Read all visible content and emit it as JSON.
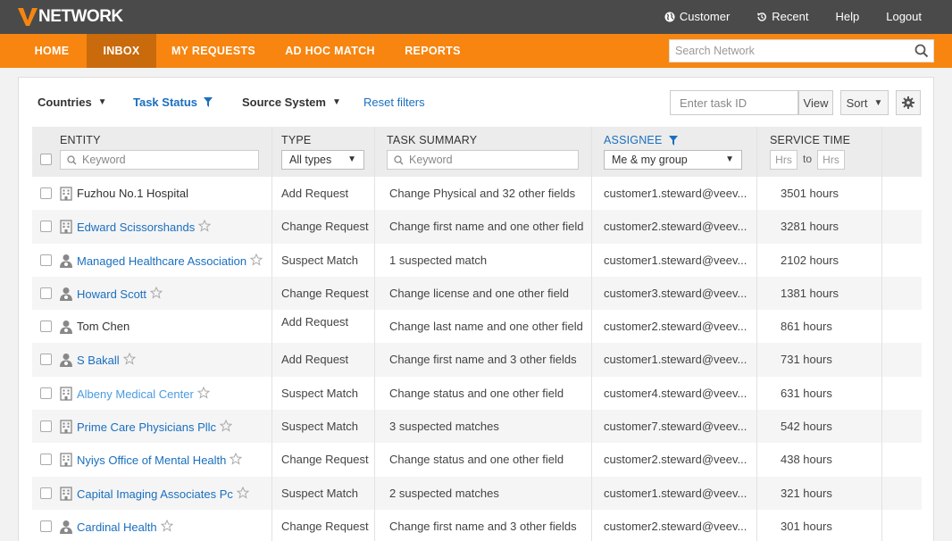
{
  "app": {
    "logo_text": "NETWORK"
  },
  "topnav": {
    "customer": "Customer",
    "recent": "Recent",
    "help": "Help",
    "logout": "Logout"
  },
  "tabs": [
    "HOME",
    "INBOX",
    "MY REQUESTS",
    "AD HOC MATCH",
    "REPORTS"
  ],
  "active_tab": "INBOX",
  "search": {
    "placeholder": "Search Network"
  },
  "filters": {
    "countries": "Countries",
    "task_status": "Task Status",
    "source_system": "Source System",
    "reset": "Reset filters"
  },
  "toolbar": {
    "task_id_placeholder": "Enter task ID",
    "view": "View",
    "sort": "Sort"
  },
  "columns": {
    "entity": "ENTITY",
    "type": "TYPE",
    "summary": "TASK SUMMARY",
    "assignee": "ASSIGNEE",
    "service_time": "SERVICE TIME",
    "keyword": "Keyword",
    "all_types": "All types",
    "assignee_value": "Me & my group",
    "hrs": "Hrs",
    "to": "to"
  },
  "colors": {
    "orange": "#f7850f",
    "active_tab": "#c96a0c",
    "link": "#1a6fbf",
    "topbar": "#4a4a4a"
  },
  "rows": [
    {
      "entity": "Fuzhou No.1 Hospital",
      "kind": "hco",
      "link": false,
      "star": false,
      "type": "Add Request",
      "summary": "Change Physical and 32 other fields",
      "assignee": "customer1.steward@veev...",
      "time": "3501 hours"
    },
    {
      "entity": "Edward Scissorshands",
      "kind": "hco",
      "link": true,
      "star": true,
      "type": "Change Request",
      "summary": "Change first name and one other field",
      "assignee": "customer2.steward@veev...",
      "time": "3281 hours"
    },
    {
      "entity": "Managed Healthcare Association",
      "kind": "hcp",
      "link": true,
      "star": true,
      "type": "Suspect Match",
      "summary": "1 suspected match",
      "assignee": "customer1.steward@veev...",
      "time": "2102 hours"
    },
    {
      "entity": "Howard Scott",
      "kind": "hcp",
      "link": true,
      "star": true,
      "type": "Change Request",
      "summary": "Change license and one other field",
      "assignee": "customer3.steward@veev...",
      "time": "1381 hours"
    },
    {
      "entity": "Tom Chen",
      "kind": "hcp",
      "link": false,
      "star": false,
      "type": "Add Request",
      "summary": "Change last name and one other field",
      "assignee": "customer2.steward@veev...",
      "time": "861 hours",
      "type_up": true
    },
    {
      "entity": "S Bakall",
      "kind": "hcp",
      "link": true,
      "star": true,
      "type": "Add Request",
      "summary": "Change first name and 3 other fields",
      "assignee": "customer1.steward@veev...",
      "time": "731 hours"
    },
    {
      "entity": "Albeny Medical Center",
      "kind": "hco",
      "link": true,
      "star": true,
      "type": "Suspect Match",
      "summary": "Change status and one other field",
      "assignee": "customer4.steward@veev...",
      "time": "631 hours",
      "light": true
    },
    {
      "entity": "Prime Care Physicians Pllc",
      "kind": "hco",
      "link": true,
      "star": true,
      "type": "Suspect Match",
      "summary": "3 suspected matches",
      "assignee": "customer7.steward@veev...",
      "time": "542 hours"
    },
    {
      "entity": "Nyiys Office of Mental Health",
      "kind": "hco",
      "link": true,
      "star": true,
      "type": "Change Request",
      "summary": "Change status and one other field",
      "assignee": "customer2.steward@veev...",
      "time": "438 hours"
    },
    {
      "entity": "Capital Imaging Associates Pc",
      "kind": "hco",
      "link": true,
      "star": true,
      "type": "Suspect Match",
      "summary": "2 suspected matches",
      "assignee": "customer1.steward@veev...",
      "time": "321 hours"
    },
    {
      "entity": "Cardinal Health",
      "kind": "hcp",
      "link": true,
      "star": true,
      "type": "Change Request",
      "summary": "Change first name and 3 other fields",
      "assignee": "customer2.steward@veev...",
      "time": "301 hours"
    }
  ]
}
